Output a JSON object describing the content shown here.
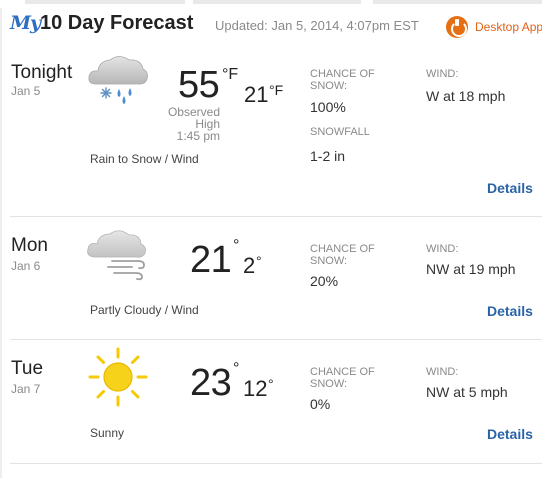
{
  "header": {
    "brand": "My",
    "title": "10 Day Forecast",
    "updated": "Updated: Jan 5, 2014, 4:07pm EST",
    "desktop_app_label": "Desktop App"
  },
  "colors": {
    "brand_blue": "#2f6fc2",
    "app_orange": "#e66f14",
    "link_blue": "#2a63a8",
    "sun_yellow": "#f7c900"
  },
  "days": [
    {
      "name": "Tonight",
      "date": "Jan 5",
      "icon": "rain-snow-cloud-icon",
      "high": "55",
      "high_unit": "°F",
      "low": "21",
      "low_unit": "°F",
      "observed_label": "Observed",
      "high_label": "High",
      "observed_time": "1:45 pm",
      "condition": "Rain to Snow / Wind",
      "precip_label_1": "CHANCE OF",
      "precip_label_2": "SNOW:",
      "precip_chance": "100%",
      "snowfall_label": "SNOWFALL",
      "snowfall": "1-2 in",
      "wind_label": "WIND:",
      "wind": "W at 18 mph",
      "details": "Details"
    },
    {
      "name": "Mon",
      "date": "Jan 6",
      "icon": "wind-cloud-icon",
      "high": "21",
      "high_unit": "°",
      "low": "2",
      "low_unit": "°",
      "condition": "Partly Cloudy / Wind",
      "precip_label_1": "CHANCE OF",
      "precip_label_2": "SNOW:",
      "precip_chance": "20%",
      "wind_label": "WIND:",
      "wind": "NW at 19 mph",
      "details": "Details"
    },
    {
      "name": "Tue",
      "date": "Jan 7",
      "icon": "sun-icon",
      "high": "23",
      "high_unit": "°",
      "low": "12",
      "low_unit": "°",
      "condition": "Sunny",
      "precip_label_1": "CHANCE OF",
      "precip_label_2": "SNOW:",
      "precip_chance": "0%",
      "wind_label": "WIND:",
      "wind": "NW at 5 mph",
      "details": "Details"
    }
  ]
}
